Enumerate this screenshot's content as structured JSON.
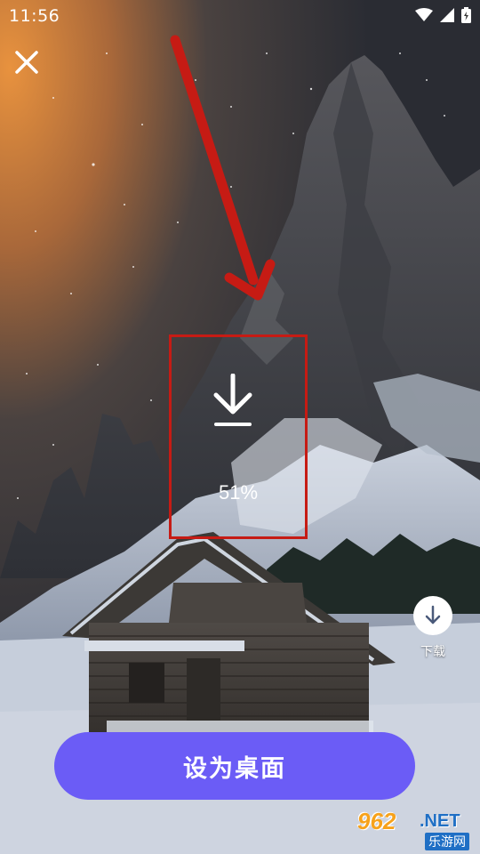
{
  "status_bar": {
    "time": "11:56",
    "icons": [
      "wifi-icon",
      "signal-icon",
      "battery-icon"
    ]
  },
  "wallpaper": {
    "description_icon": "mountain-cabin-night"
  },
  "download_overlay": {
    "icon": "download-arrow-icon",
    "percent_text": "51%",
    "progress": 0.51
  },
  "side_actions": {
    "download_label": "下载",
    "download_icon": "download-icon"
  },
  "primary_button": {
    "label": "设为桌面"
  },
  "watermark": {
    "brand": "962",
    "suffix": ".NET",
    "sub": "乐游网"
  },
  "colors": {
    "button": "#6b5cf6",
    "highlight_box": "#c61b14",
    "arrow": "#c61b14",
    "sky_glow": "#e8923e"
  }
}
